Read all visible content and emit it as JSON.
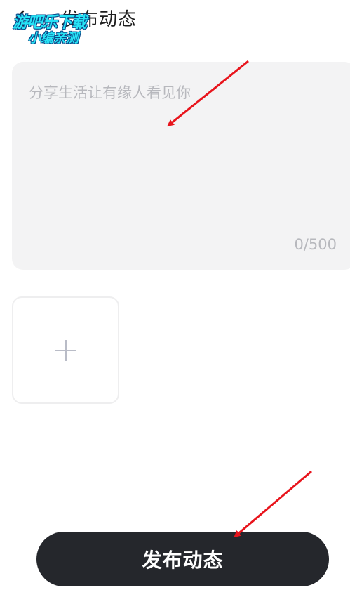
{
  "header": {
    "title": "发布动态",
    "back_icon": "chevron-left-icon"
  },
  "watermark": {
    "line1": "游吧乐下载",
    "line2": "小编亲测",
    "color": "#27e3f5"
  },
  "post_input": {
    "placeholder": "分享生活让有缘人看见你",
    "value": "",
    "char_count": "0/500"
  },
  "media": {
    "add_icon": "plus-icon"
  },
  "publish_button": {
    "label": "发布动态",
    "background": "#25272c"
  },
  "annotations": {
    "arrow_color": "#e8141c"
  }
}
